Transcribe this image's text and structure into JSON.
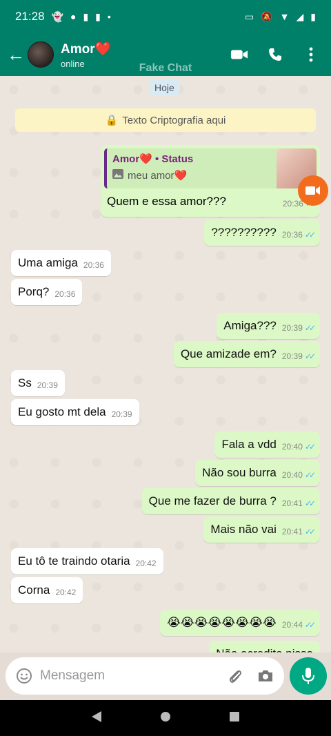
{
  "status_bar": {
    "time": "21:28"
  },
  "header": {
    "contact_name": "Amor❤️",
    "presence": "online",
    "watermark": "Fake Chat"
  },
  "chat": {
    "date_pill": "Hoje",
    "encryption_notice": "Texto Criptografia aqui",
    "quoted": {
      "author": "Amor❤️ • Status",
      "caption": "meu amor❤️",
      "text": "Quem e essa amor???",
      "time": "20:36"
    },
    "messages": [
      {
        "dir": "out",
        "text": "??????????",
        "time": "20:36"
      },
      {
        "dir": "in",
        "text": "Uma amiga",
        "time": "20:36"
      },
      {
        "dir": "in",
        "text": "Porq?",
        "time": "20:36"
      },
      {
        "dir": "out",
        "text": "Amiga???",
        "time": "20:39"
      },
      {
        "dir": "out",
        "text": "Que amizade em?",
        "time": "20:39"
      },
      {
        "dir": "in",
        "text": "Ss",
        "time": "20:39"
      },
      {
        "dir": "in",
        "text": "Eu gosto mt dela",
        "time": "20:39"
      },
      {
        "dir": "out",
        "text": "Fala a vdd",
        "time": "20:40"
      },
      {
        "dir": "out",
        "text": "Não sou burra",
        "time": "20:40"
      },
      {
        "dir": "out",
        "text": "Que me fazer de burra ?",
        "time": "20:41"
      },
      {
        "dir": "out",
        "text": "Mais não vai",
        "time": "20:41"
      },
      {
        "dir": "in",
        "text": "Eu tô te traindo otaria",
        "time": "20:42"
      },
      {
        "dir": "in",
        "text": "Corna",
        "time": "20:42"
      },
      {
        "dir": "out",
        "text": "😭😭😭😭😭😭😭😭",
        "time": "20:44"
      },
      {
        "dir": "out",
        "text": "Não acredito nisso",
        "time": ""
      }
    ]
  },
  "composer": {
    "placeholder": "Mensagem"
  },
  "colors": {
    "header": "#008069",
    "outgoing": "#dcf8c6",
    "incoming": "#ffffff",
    "fab": "#00a884",
    "read_ticks": "#4fb6ec"
  }
}
